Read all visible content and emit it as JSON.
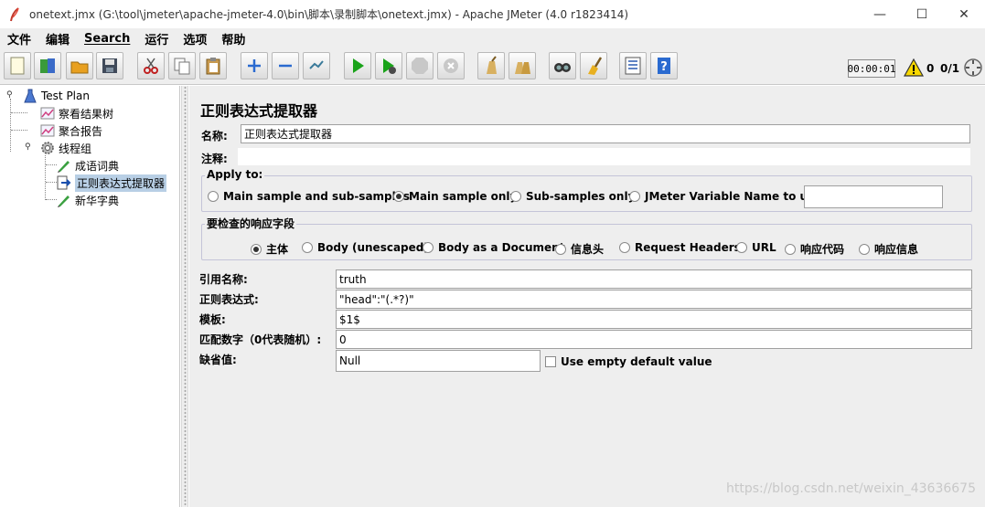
{
  "window": {
    "title": "onetext.jmx (G:\\tool\\jmeter\\apache-jmeter-4.0\\bin\\脚本\\录制脚本\\onetext.jmx) - Apache JMeter (4.0 r1823414)",
    "minimize": "—",
    "maximize": "☐",
    "close": "✕"
  },
  "menu": {
    "items": [
      "文件",
      "编辑",
      "Search",
      "运行",
      "选项",
      "帮助"
    ]
  },
  "toolbar": {
    "timer": "00:00:01",
    "warning_count": "0",
    "threads": "0/1",
    "buttons": [
      "new-icon",
      "templates-icon",
      "open-icon",
      "save-icon",
      "cut-icon",
      "copy-icon",
      "paste-icon",
      "expand-icon",
      "collapse-icon",
      "toggle-icon",
      "start-icon",
      "start-no-pause-icon",
      "stop-icon",
      "shutdown-icon",
      "clear-icon",
      "clear-all-icon",
      "search-icon",
      "reset-search-icon",
      "function-helper-icon",
      "help-icon"
    ]
  },
  "tree": {
    "nodes": [
      {
        "label": "Test Plan"
      },
      {
        "label": "察看结果树"
      },
      {
        "label": "聚合报告"
      },
      {
        "label": "线程组"
      },
      {
        "label": "成语词典"
      },
      {
        "label": "正则表达式提取器"
      },
      {
        "label": "新华字典"
      }
    ],
    "selected_index": 5
  },
  "panel": {
    "title": "正则表达式提取器",
    "name_label": "名称:",
    "name_value": "正则表达式提取器",
    "comment_label": "注释:",
    "comment_value": "",
    "apply_to": {
      "title": "Apply to:",
      "options": [
        "Main sample and sub-samples",
        "Main sample only",
        "Sub-samples only",
        "JMeter Variable Name to use"
      ],
      "selected_index": 1,
      "variable_value": ""
    },
    "field_to_check": {
      "title": "要检查的响应字段",
      "options": [
        "主体",
        "Body (unescaped)",
        "Body as a Document",
        "信息头",
        "Request Headers",
        "URL",
        "响应代码",
        "响应信息"
      ],
      "selected_index": 0
    },
    "ref_name_label": "引用名称:",
    "ref_name_value": "truth",
    "regex_label": "正则表达式:",
    "regex_value": "\"head\":\"(.*?)\"",
    "template_label": "模板:",
    "template_value": "$1$",
    "match_no_label": "匹配数字（0代表随机）:",
    "match_no_value": "0",
    "default_label": "缺省值:",
    "default_value": "Null",
    "use_empty_default_label": "Use empty default value",
    "use_empty_default_checked": false
  },
  "watermark": "https://blog.csdn.net/weixin_43636675",
  "colors": {
    "panel_bg": "#eeeeee",
    "selection": "#b8cfe5",
    "start_green": "#1aa31a"
  }
}
